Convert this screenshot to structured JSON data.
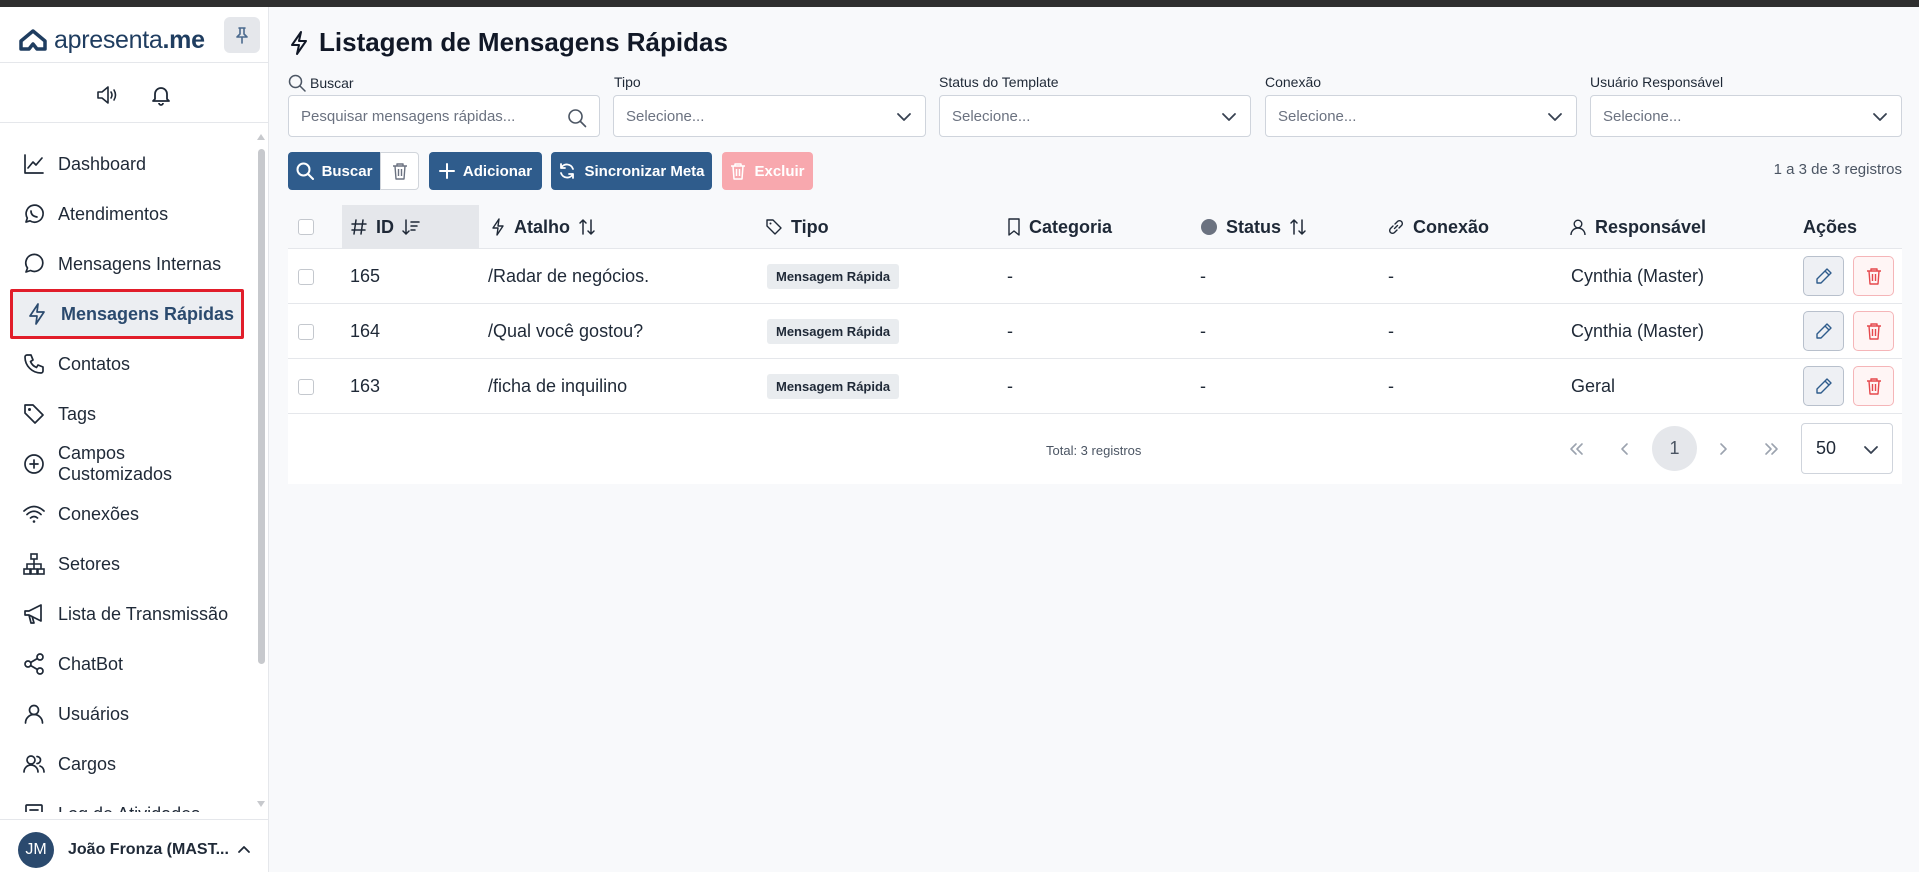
{
  "app": {
    "logo_light": "apresenta",
    "logo_bold": ".me"
  },
  "sidebar": {
    "items": [
      {
        "label": "Dashboard",
        "icon": "chart-line-icon"
      },
      {
        "label": "Atendimentos",
        "icon": "whatsapp-icon"
      },
      {
        "label": "Mensagens Internas",
        "icon": "chat-bubble-icon"
      },
      {
        "label": "Mensagens Rápidas",
        "icon": "lightning-icon",
        "active": true
      },
      {
        "label": "Contatos",
        "icon": "phone-icon"
      },
      {
        "label": "Tags",
        "icon": "tag-icon"
      },
      {
        "label": "Campos Customizados",
        "icon": "plus-circle-icon"
      },
      {
        "label": "Conexões",
        "icon": "wifi-icon"
      },
      {
        "label": "Setores",
        "icon": "sitemap-icon"
      },
      {
        "label": "Lista de Transmissão",
        "icon": "megaphone-icon"
      },
      {
        "label": "ChatBot",
        "icon": "share-icon"
      },
      {
        "label": "Usuários",
        "icon": "user-icon"
      },
      {
        "label": "Cargos",
        "icon": "users-icon"
      },
      {
        "label": "Log de Atividades",
        "icon": "log-icon"
      }
    ],
    "user": {
      "initials": "JM",
      "name": "João Fronza (MAST..."
    }
  },
  "page": {
    "title": "Listagem de Mensagens Rápidas"
  },
  "filters": {
    "search_label": "Buscar",
    "search_placeholder": "Pesquisar mensagens rápidas...",
    "tipo_label": "Tipo",
    "tipo_value": "Selecione...",
    "status_label": "Status do Template",
    "status_value": "Selecione...",
    "conexao_label": "Conexão",
    "conexao_value": "Selecione...",
    "usuario_label": "Usuário Responsável",
    "usuario_value": "Selecione..."
  },
  "toolbar": {
    "buscar": "Buscar",
    "adicionar": "Adicionar",
    "sincronizar": "Sincronizar Meta",
    "excluir": "Excluir",
    "records": "1 a 3 de 3 registros"
  },
  "table": {
    "headers": {
      "id": "ID",
      "atalho": "Atalho",
      "tipo": "Tipo",
      "categoria": "Categoria",
      "status": "Status",
      "conexao": "Conexão",
      "responsavel": "Responsável",
      "acoes": "Ações"
    },
    "rows": [
      {
        "id": "165",
        "atalho": "/Radar de negócios.",
        "tipo": "Mensagem Rápida",
        "categoria": "-",
        "status": "-",
        "conexao": "-",
        "responsavel": "Cynthia (Master)"
      },
      {
        "id": "164",
        "atalho": "/Qual você gostou?",
        "tipo": "Mensagem Rápida",
        "categoria": "-",
        "status": "-",
        "conexao": "-",
        "responsavel": "Cynthia (Master)"
      },
      {
        "id": "163",
        "atalho": "/ficha de inquilino",
        "tipo": "Mensagem Rápida",
        "categoria": "-",
        "status": "-",
        "conexao": "-",
        "responsavel": "Geral"
      }
    ]
  },
  "pagination": {
    "total": "Total: 3 registros",
    "current_page": "1",
    "per_page": "50"
  },
  "colors": {
    "primary": "#2f5c8c",
    "active_outline": "#e11d2a",
    "danger_light": "#f8a8ae"
  }
}
